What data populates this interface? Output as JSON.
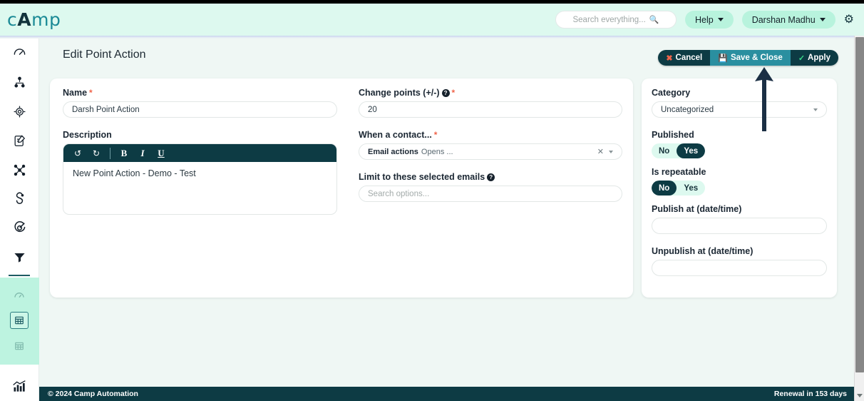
{
  "header": {
    "brand_prefix": "c",
    "brand_cap": "A",
    "brand_suffix": "mp",
    "search_placeholder": "Search everything...",
    "search_icon": "search-icon",
    "help_label": "Help",
    "user_label": "Darshan Madhu",
    "gear_icon": "gear-icon"
  },
  "page": {
    "title": "Edit Point Action"
  },
  "actions": {
    "cancel_label": "Cancel",
    "save_close_label": "Save & Close",
    "apply_label": "Apply"
  },
  "sidebar": {
    "items": [
      {
        "name": "dashboard-gauge-icon"
      },
      {
        "name": "hierarchy-icon"
      },
      {
        "name": "target-globe-icon"
      },
      {
        "name": "form-edit-icon"
      },
      {
        "name": "campaign-nodes-icon"
      },
      {
        "name": "stages-icon"
      },
      {
        "name": "goal-target-icon"
      },
      {
        "name": "funnel-icon"
      }
    ],
    "group_items": [
      {
        "name": "speedometer-icon"
      },
      {
        "name": "report-table-icon"
      },
      {
        "name": "grid-icon"
      }
    ],
    "bottom_items": [
      {
        "name": "analytics-chart-icon"
      }
    ]
  },
  "form": {
    "name": {
      "label": "Name",
      "required": "*",
      "value": "Darsh Point Action"
    },
    "description": {
      "label": "Description",
      "toolbar": {
        "undo": "↺",
        "redo": "↻",
        "bold": "B",
        "italic": "I",
        "underline": "U"
      },
      "value": "New Point Action - Demo - Test"
    },
    "change_points": {
      "label": "Change points (+/-)",
      "help": "?",
      "required": "*",
      "value": "20"
    },
    "when_contact": {
      "label": "When a contact...",
      "required": "*",
      "group": "Email actions",
      "value": "Opens ...",
      "clear": "✕"
    },
    "limit_emails": {
      "label": "Limit to these selected emails",
      "help": "?",
      "placeholder": "Search options..."
    },
    "category": {
      "label": "Category",
      "value": "Uncategorized"
    },
    "published": {
      "label": "Published",
      "options": [
        "No",
        "Yes"
      ],
      "selected": "Yes"
    },
    "is_repeatable": {
      "label": "Is repeatable",
      "options": [
        "No",
        "Yes"
      ],
      "selected": "No"
    },
    "publish_at": {
      "label": "Publish at (date/time)",
      "value": ""
    },
    "unpublish_at": {
      "label": "Unpublish at (date/time)",
      "value": ""
    }
  },
  "annotation": {
    "arrow": "up-arrow-annotation",
    "color": "#1b2f44"
  },
  "footer": {
    "copyright": "© 2024 Camp Automation",
    "renewal": "Renewal in 153 days"
  },
  "colors": {
    "header_bg": "#ddf9ef",
    "page_bg": "#eff7f4",
    "accent_dark": "#0d3b44",
    "accent_mid": "#2a8fa0",
    "required": "#f0644a"
  }
}
